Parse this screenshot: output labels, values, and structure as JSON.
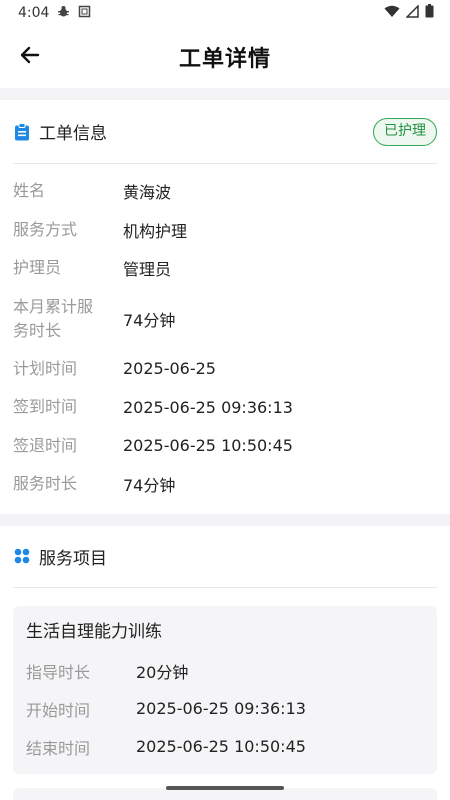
{
  "status_bar": {
    "time": "4:04"
  },
  "app_bar": {
    "title": "工单详情"
  },
  "order_info": {
    "section_title": "工单信息",
    "status": "已护理",
    "rows": [
      {
        "label": "姓名",
        "value": "黄海波"
      },
      {
        "label": "服务方式",
        "value": "机构护理"
      },
      {
        "label": "护理员",
        "value": "管理员"
      },
      {
        "label": "本月累计服务时长",
        "value": "74分钟"
      },
      {
        "label": "计划时间",
        "value": "2025-06-25"
      },
      {
        "label": "签到时间",
        "value": "2025-06-25 09:36:13"
      },
      {
        "label": "签退时间",
        "value": "2025-06-25 10:50:45"
      },
      {
        "label": "服务时长",
        "value": "74分钟"
      }
    ]
  },
  "service_items": {
    "section_title": "服务项目",
    "items": [
      {
        "name": "生活自理能力训练",
        "rows": [
          {
            "label": "指导时长",
            "value": "20分钟"
          },
          {
            "label": "开始时间",
            "value": "2025-06-25 09:36:13"
          },
          {
            "label": "结束时间",
            "value": "2025-06-25 10:50:45"
          }
        ]
      }
    ]
  },
  "colors": {
    "accent_blue": "#1e88e5",
    "status_green": "#34a853"
  }
}
